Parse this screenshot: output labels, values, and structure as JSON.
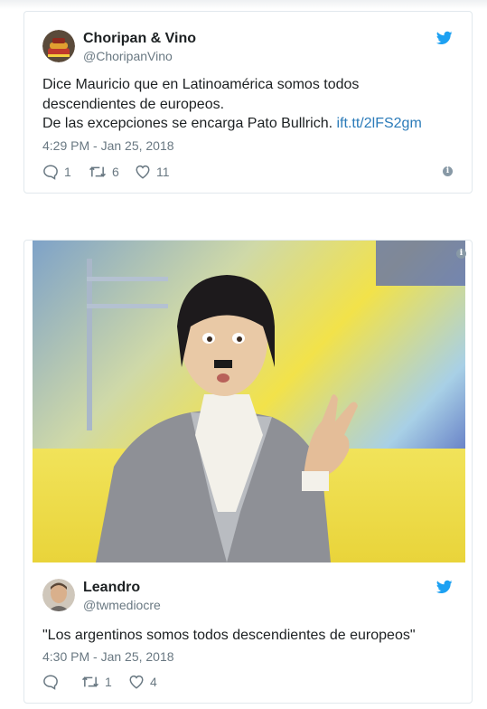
{
  "tweets": [
    {
      "name": "Choripan & Vino",
      "handle": "@ChoripanVino",
      "text_line1": "Dice Mauricio que en Latinoamérica somos todos",
      "text_line2": "descendientes de europeos.",
      "text_line3": "De las excepciones se encarga Pato Bullrich.",
      "link": "ift.tt/2lFS2gm",
      "timestamp": "4:29 PM - Jan 25, 2018",
      "replies": "1",
      "retweets": "6",
      "likes": "11"
    },
    {
      "name": "Leandro",
      "handle": "@twmediocre",
      "text": "\"Los argentinos somos todos descendientes de europeos\"",
      "timestamp": "4:30 PM - Jan 25, 2018",
      "replies": "",
      "retweets": "1",
      "likes": "4"
    }
  ],
  "info_glyph": "i",
  "colors": {
    "link": "#2b7bb9",
    "twitter_blue": "#1da1f2",
    "meta_gray": "#697882",
    "border": "#e1e8ed"
  },
  "icons": [
    "reply-icon",
    "retweet-icon",
    "heart-icon",
    "twitter-bird-icon",
    "info-icon"
  ]
}
